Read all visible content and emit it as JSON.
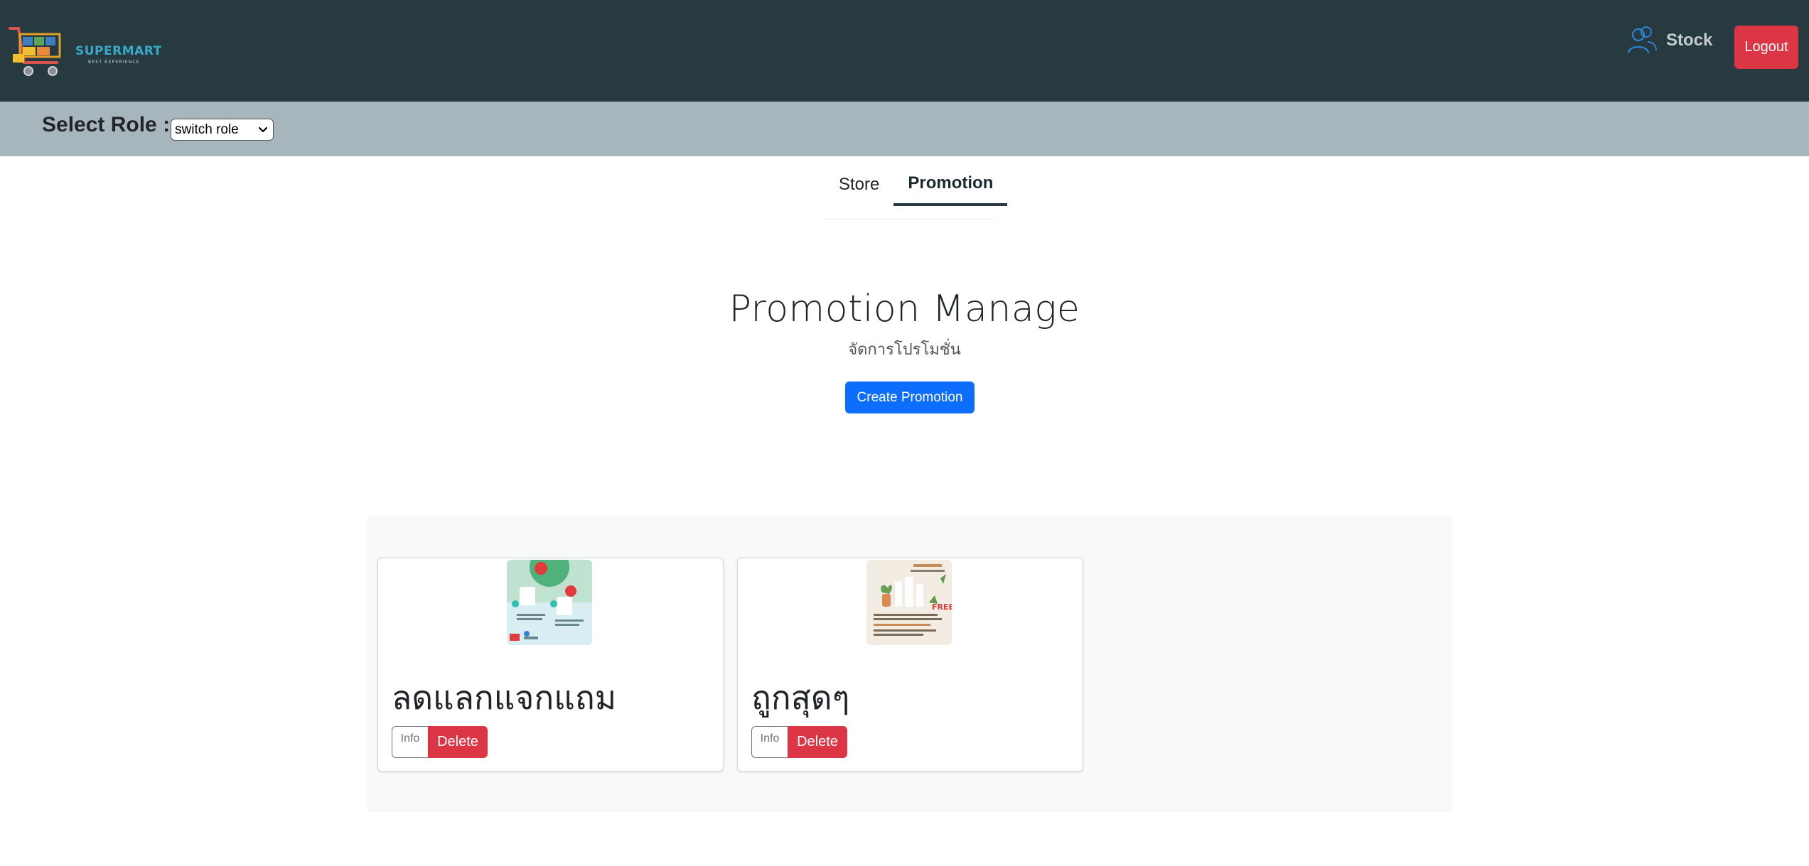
{
  "navbar": {
    "brand": "SUPERMART",
    "brand_tagline": "BEST EXPERIENCE",
    "stock_label": "Stock",
    "logout_label": "Logout",
    "icons": {
      "logo": "shopping-cart-icon",
      "stock": "users-icon"
    },
    "colors": {
      "background": "#263a40",
      "logout": "#dc3545"
    }
  },
  "rolebar": {
    "label": "Select Role :",
    "select_value": "switch role",
    "background": "#a7b5bd"
  },
  "tabs": [
    {
      "label": "Store",
      "active": false
    },
    {
      "label": "Promotion",
      "active": true
    }
  ],
  "main": {
    "title": "Promotion Manage",
    "subtitle": "จัดการโปรโมชั่น",
    "create_button": "Create Promotion",
    "accent": "#0d6efd"
  },
  "promotions": [
    {
      "title": "ลดแลกแจกแถม",
      "info_label": "Info",
      "delete_label": "Delete",
      "image": "promotion-poster-1"
    },
    {
      "title": "ถูกสุดๆ",
      "info_label": "Info",
      "delete_label": "Delete",
      "image": "promotion-poster-2"
    }
  ]
}
